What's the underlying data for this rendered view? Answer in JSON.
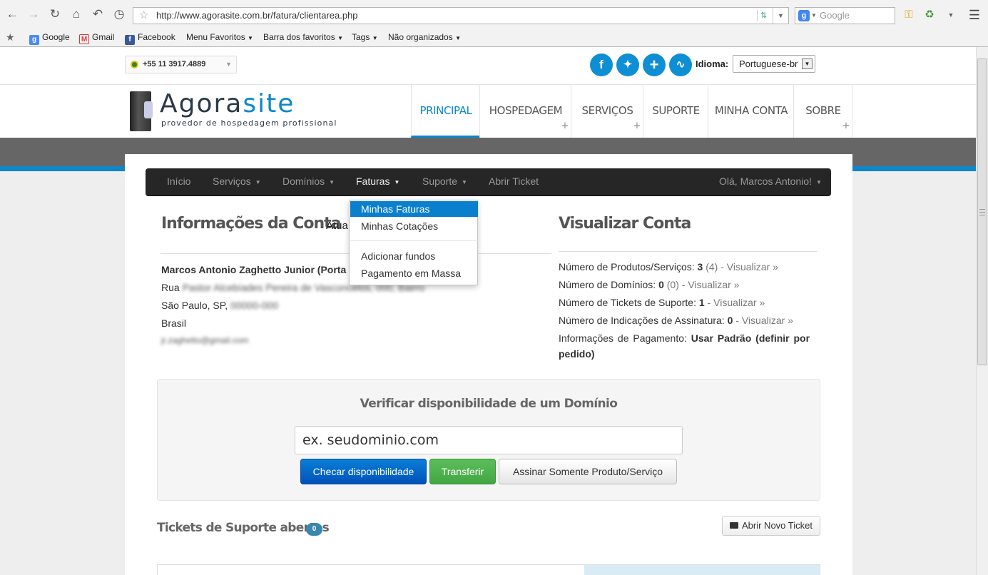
{
  "browser": {
    "url": "http://www.agorasite.com.br/fatura/clientarea.php",
    "search_placeholder": "Google",
    "bookmarks": [
      "Google",
      "Gmail",
      "Facebook",
      "Menu Favoritos",
      "Barra dos favoritos",
      "Tags",
      "Não organizados"
    ]
  },
  "topbar": {
    "phone": "+55 11 3917.4889",
    "language_label": "Idioma:",
    "language_value": "Portuguese-br",
    "social_icons": [
      "facebook-icon",
      "twitter-icon",
      "share-plus-icon",
      "rss-icon"
    ]
  },
  "logo": {
    "name_part1": "Agora",
    "name_part2": "site",
    "tagline": "provedor de hospedagem profissional"
  },
  "main_nav": [
    "PRINCIPAL",
    "HOSPEDAGEM",
    "SERVIÇOS",
    "SUPORTE",
    "MINHA CONTA",
    "SOBRE"
  ],
  "client_nav": {
    "items": [
      "Início",
      "Serviços",
      "Domínios",
      "Faturas",
      "Suporte",
      "Abrir Ticket"
    ],
    "greeting": "Olá, Marcos Antonio!"
  },
  "faturas_menu": [
    "Minhas Faturas",
    "Minhas Cotações",
    "Adicionar fundos",
    "Pagamento em Massa"
  ],
  "account": {
    "title": "Informações da Conta",
    "update_link": "Atua",
    "name": "Marcos Antonio Zaghetto Junior (Porta",
    "street_prefix": "Rua",
    "street_blurred": "Pastor Alcebíades Pereira de Vasconcelos, 000, Bairro",
    "city": "São Paulo, SP,",
    "zip_blurred": "00000-000",
    "country": "Brasil",
    "email_blurred": "jr.zaghetto@gmail.com"
  },
  "overview": {
    "title": "Visualizar Conta",
    "products_label": "Número de Produtos/Serviços:",
    "products_count": "3",
    "products_total": "(4)",
    "domains_label": "Número de Domínios:",
    "domains_count": "0",
    "domains_total": "(0)",
    "tickets_label": "Número de Tickets de Suporte:",
    "tickets_count": "1",
    "referrals_label": "Número de Indicações de Assinatura:",
    "referrals_count": "0",
    "view_link": "- Visualizar »",
    "payment_label": "Informações de Pagamento:",
    "payment_value_1": "Usar Padrão (definir por",
    "payment_value_2": "pedido)"
  },
  "domain_check": {
    "title": "Verificar disponibilidade de um Domínio",
    "input_value": "ex. seudominio.com",
    "btn_check": "Checar disponibilidade",
    "btn_transfer": "Transferir",
    "btn_product": "Assinar Somente Produto/Serviço"
  },
  "tickets": {
    "title": "Tickets de Suporte abertos",
    "count": "0",
    "new_ticket_btn": "Abrir Novo Ticket"
  },
  "colors": {
    "brand_blue": "#0c87c9",
    "nav_dark": "#262626",
    "highlight": "#0a7fcd",
    "primary_button": "#0a6cd0",
    "success_button": "#4cb04c"
  }
}
